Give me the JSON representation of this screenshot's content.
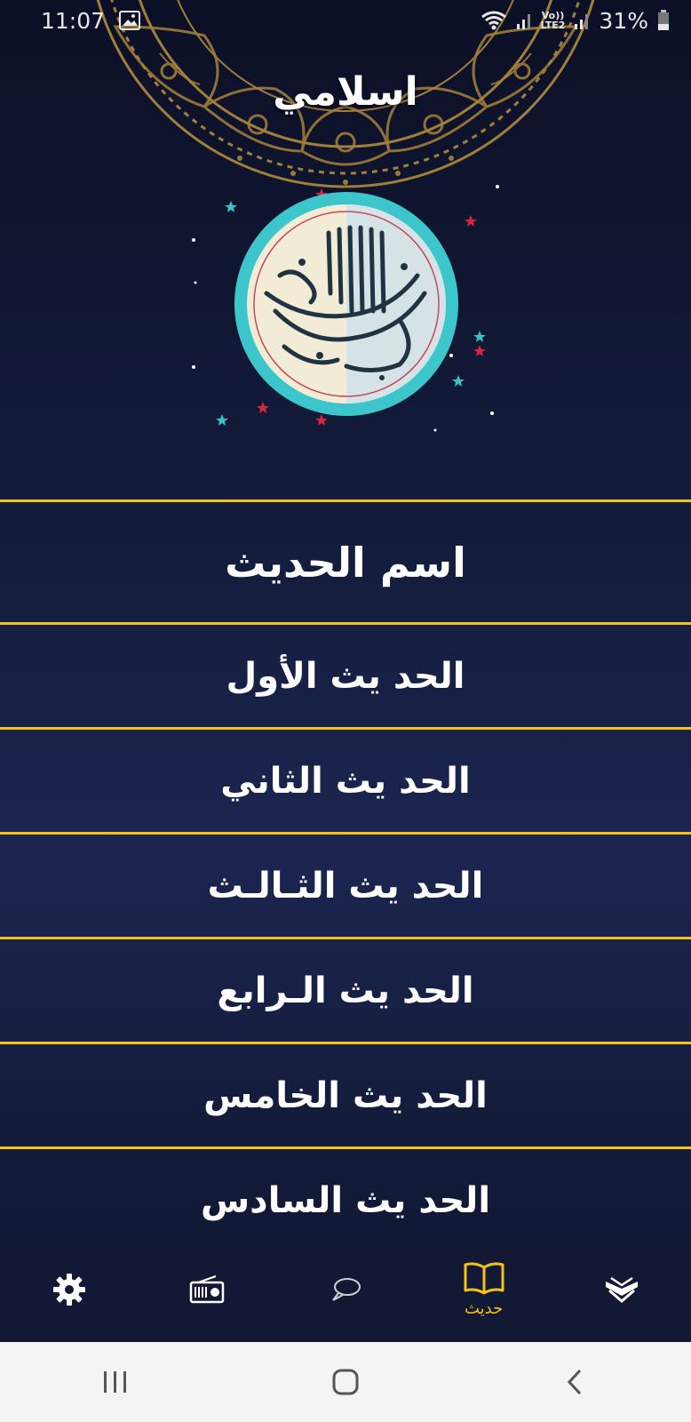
{
  "status_bar": {
    "time": "11:07",
    "network": "Vo)\nLTE2",
    "network_line1": "Vo))",
    "network_line2": "LTE2",
    "battery": "31%"
  },
  "app": {
    "title": "اسلامي"
  },
  "hadith_list": {
    "header": "اسم الحديث",
    "items": [
      {
        "label": "الحد يث الأول"
      },
      {
        "label": "الحد يث الثاني"
      },
      {
        "label": "الحد يث الثـالـث"
      },
      {
        "label": "الحد يث الـرابع"
      },
      {
        "label": "الحد يث الخامس"
      },
      {
        "label": "الحد يث السادس"
      }
    ]
  },
  "bottom_nav": {
    "items": [
      {
        "icon": "settings-icon",
        "label": ""
      },
      {
        "icon": "radio-icon",
        "label": ""
      },
      {
        "icon": "chat-icon",
        "label": ""
      },
      {
        "icon": "book-icon",
        "label": "حديث",
        "active": true
      },
      {
        "icon": "quran-icon",
        "label": ""
      }
    ]
  },
  "colors": {
    "accent": "#f2c316",
    "background": "#151d3e",
    "nav_background": "#131935"
  }
}
